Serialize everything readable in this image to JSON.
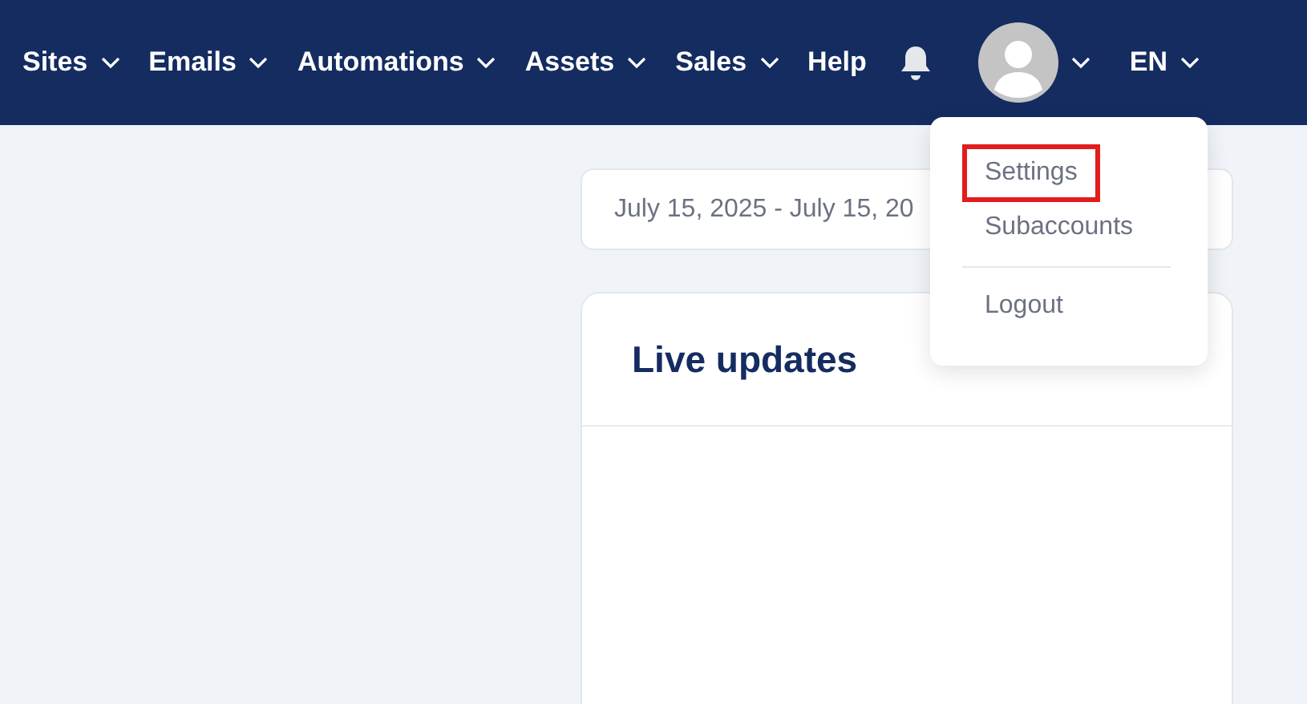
{
  "nav": {
    "items": [
      {
        "label": "Sites",
        "dropdown": true
      },
      {
        "label": "Emails",
        "dropdown": true
      },
      {
        "label": "Automations",
        "dropdown": true
      },
      {
        "label": "Assets",
        "dropdown": true
      },
      {
        "label": "Sales",
        "dropdown": true
      },
      {
        "label": "Help",
        "dropdown": false
      }
    ],
    "language": "EN"
  },
  "date_range": "July 15, 2025 - July 15, 20",
  "card": {
    "title": "Live updates"
  },
  "user_menu": {
    "items": [
      {
        "label": "Settings",
        "highlighted": true
      },
      {
        "label": "Subaccounts",
        "highlighted": false
      },
      {
        "label": "Logout",
        "highlighted": false
      }
    ]
  }
}
